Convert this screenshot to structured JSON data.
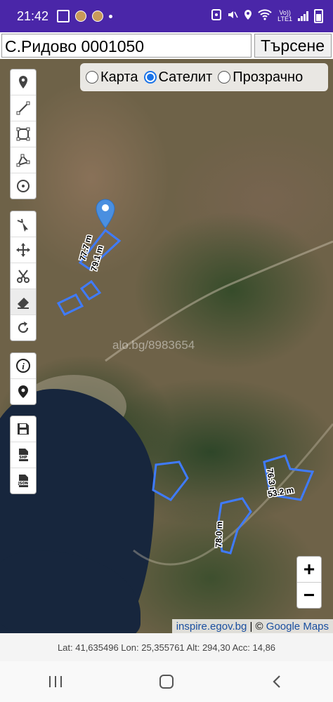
{
  "status_bar": {
    "time": "21:42",
    "volte_top": "Vo))",
    "volte_bottom": "LTE1",
    "icons": [
      "image-icon",
      "coin-icon",
      "coin-icon",
      "notification-dot-icon",
      "sim-icon",
      "mute-icon",
      "location-icon",
      "wifi-icon",
      "volte-icon",
      "signal-icon",
      "battery-icon"
    ]
  },
  "search": {
    "value": "С.Ридово 0001050",
    "button_label": "Търсене"
  },
  "layers": {
    "options": [
      {
        "label": "Карта",
        "selected": false
      },
      {
        "label": "Сателит",
        "selected": true
      },
      {
        "label": "Прозрачно",
        "selected": false
      }
    ]
  },
  "tools": {
    "draw": [
      "marker-icon",
      "polyline-icon",
      "rectangle-icon",
      "polygon-icon",
      "circle-icon"
    ],
    "edit": [
      "cursor-edit-icon",
      "move-icon",
      "cut-icon",
      "eraser-icon",
      "rotate-icon"
    ],
    "info": [
      "info-icon",
      "locate-pin-icon"
    ],
    "export": [
      "save-icon",
      "shp-file-icon",
      "json-file-icon"
    ],
    "export_labels": {
      "shp": "SHP",
      "json": "JSON"
    }
  },
  "measurements": {
    "m1": "77.7 m",
    "m2": "79.1 m",
    "m3": "78.0 m",
    "m4": "76.3 m",
    "m5": "53.2 m"
  },
  "map": {
    "watermark": "alo.bg/8983654",
    "attribution_link1": "inspire.egov.bg",
    "attribution_sep": " | © ",
    "attribution_link2": "Google Maps",
    "colors": {
      "shape": "#3f7bff",
      "marker": "#4a8fe0"
    }
  },
  "zoom": {
    "in": "+",
    "out": "−"
  },
  "gps": {
    "text": "Lat: 41,635496 Lon: 25,355761 Alt: 294,30 Acc: 14,86"
  },
  "nav": [
    "recent-apps-icon",
    "home-icon",
    "back-icon"
  ]
}
